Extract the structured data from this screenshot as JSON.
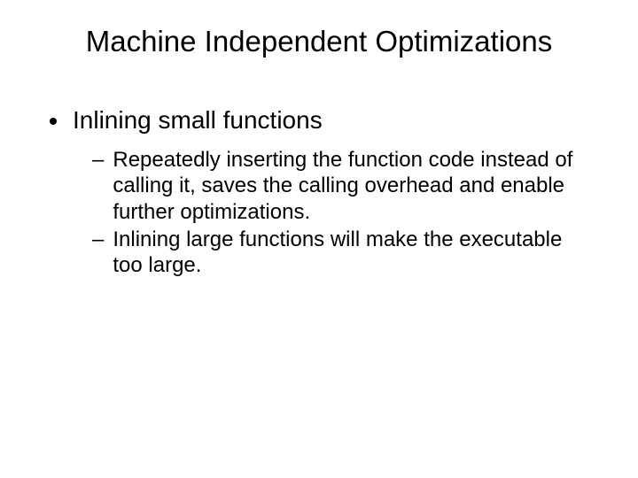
{
  "slide": {
    "title": "Machine Independent Optimizations",
    "bullet1": "Inlining small functions",
    "sub1_dash": "–",
    "sub1": "Repeatedly inserting the function code instead of calling it, saves the calling overhead and enable further optimizations.",
    "sub2_dash": "–",
    "sub2": "Inlining large functions will make the executable too large."
  }
}
